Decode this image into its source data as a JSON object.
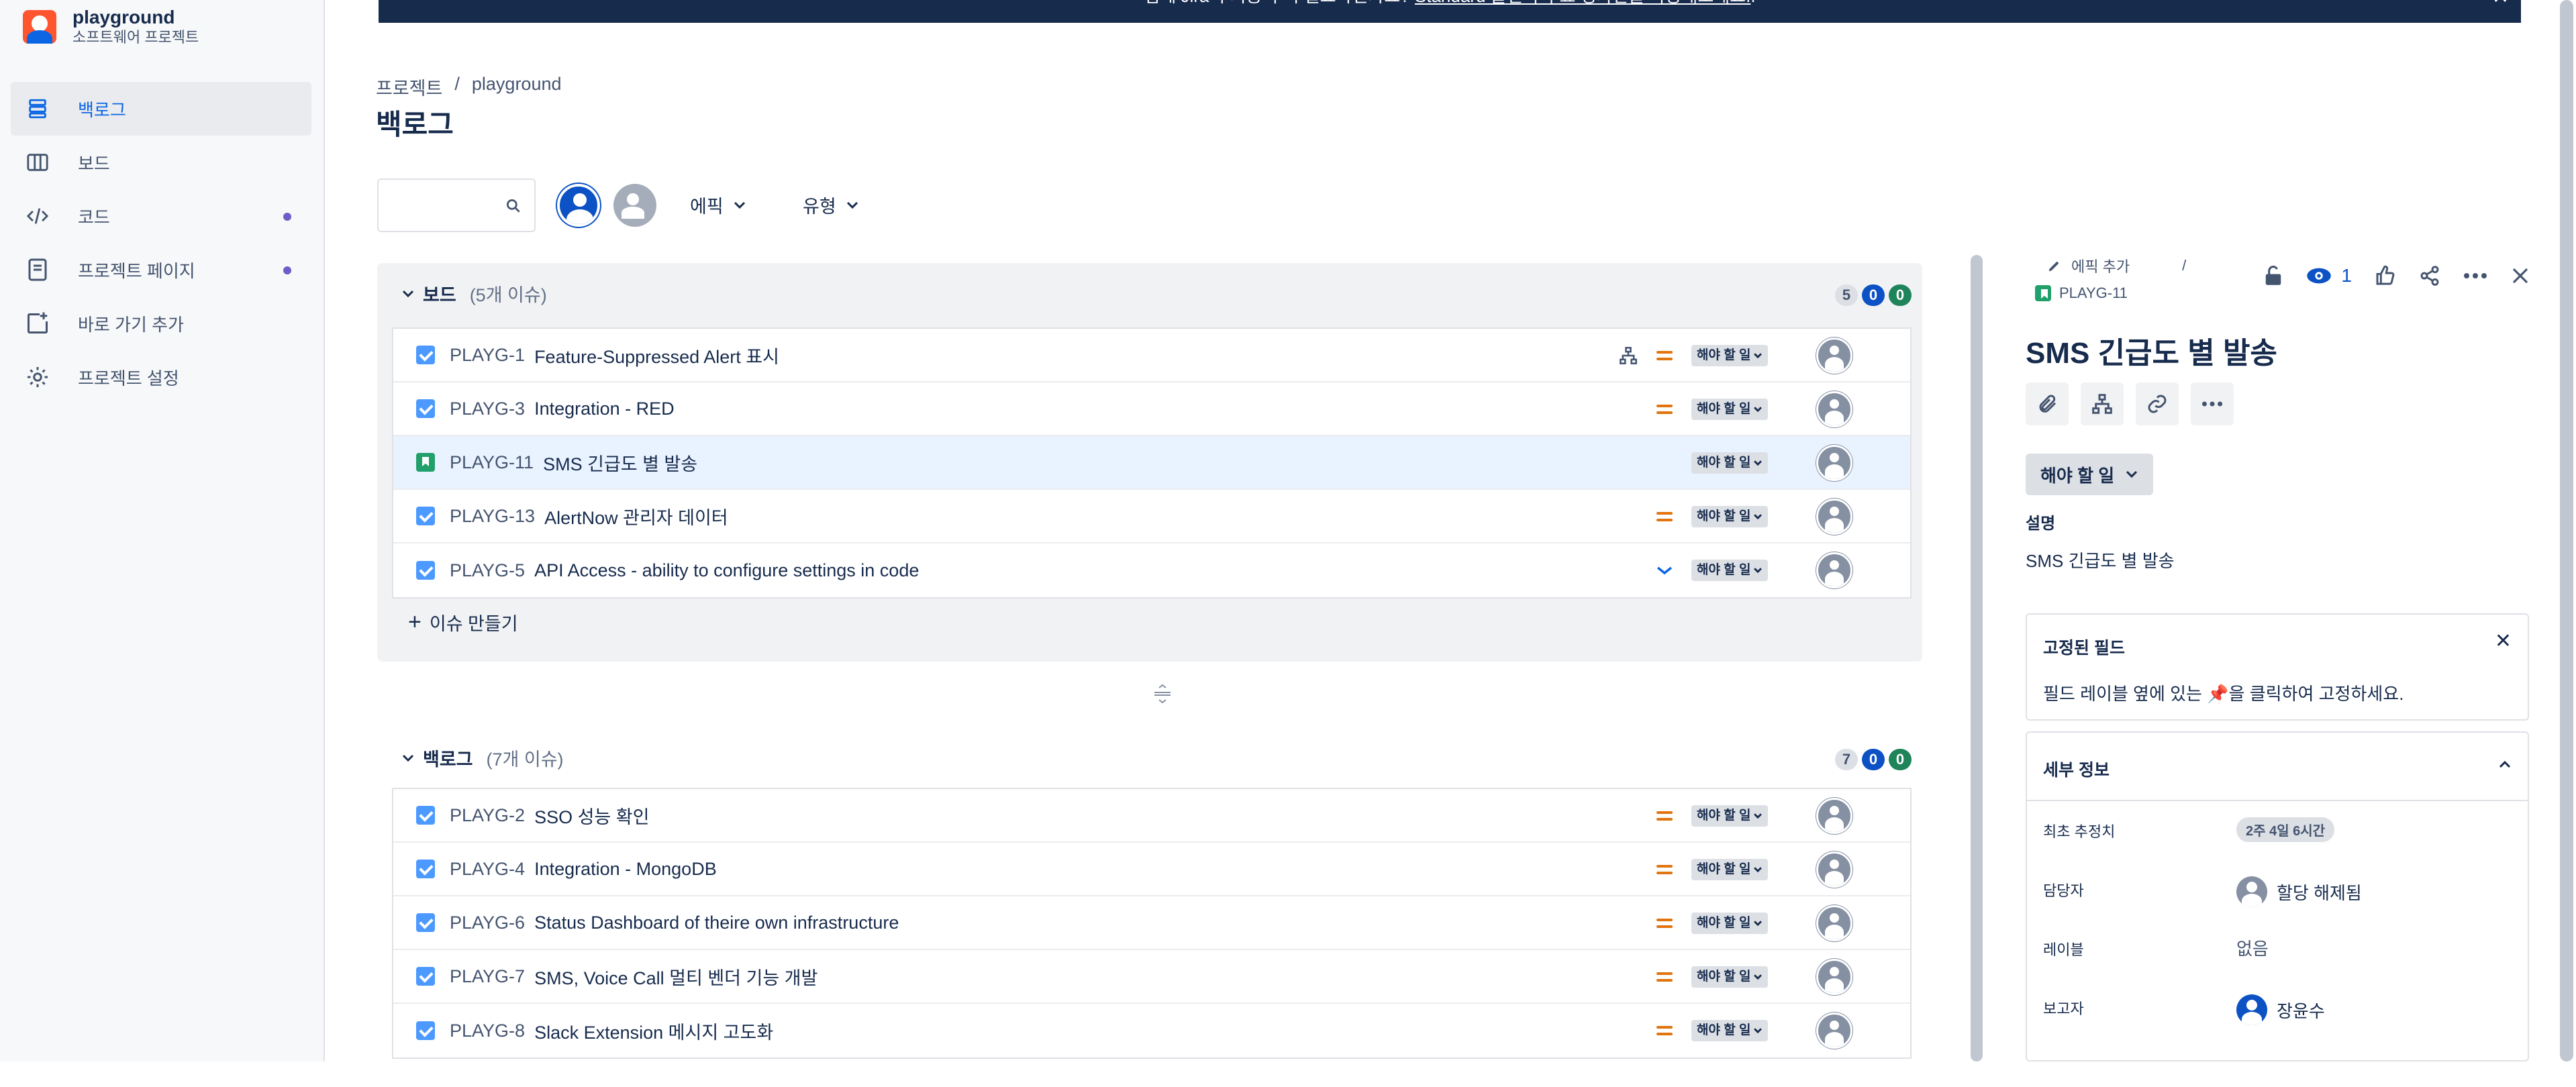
{
  "sidebar": {
    "project_name": "playground",
    "project_type": "소프트웨어 프로젝트",
    "items": [
      {
        "label": "백로그",
        "icon": "backlog-icon",
        "active": true
      },
      {
        "label": "보드",
        "icon": "board-icon"
      },
      {
        "label": "코드",
        "icon": "code-icon",
        "dot": true
      },
      {
        "label": "프로젝트 페이지",
        "icon": "page-icon",
        "dot": true
      },
      {
        "label": "바로 가기 추가",
        "icon": "add-shortcut-icon"
      },
      {
        "label": "프로젝트 설정",
        "icon": "settings-icon"
      }
    ]
  },
  "banner": {
    "text": "팀에 Jira의 기능이 더 필요하신가요?",
    "link": "Standard 플랜의 무료 평가판을 사용해보세요.",
    "tail": "."
  },
  "header": {
    "breadcrumb": [
      "프로젝트",
      "/",
      "playground"
    ],
    "title": "백로그"
  },
  "search": {
    "placeholder": ""
  },
  "filters": {
    "epic": "에픽",
    "type": "유형"
  },
  "board_section": {
    "title": "보드",
    "count": "(5개 이슈)",
    "counts": [
      "5",
      "0",
      "0"
    ],
    "create_label": "이슈 만들기",
    "issues": [
      {
        "key": "PLAYG-1",
        "summary": "Feature-Suppressed Alert 표시",
        "status": "해야 할 일",
        "priority": "medium",
        "type": "task",
        "child": true
      },
      {
        "key": "PLAYG-3",
        "summary": "Integration - RED",
        "status": "해야 할 일",
        "priority": "medium",
        "type": "task"
      },
      {
        "key": "PLAYG-11",
        "summary": "SMS 긴급도 별 발송",
        "status": "해야 할 일",
        "priority": "none",
        "type": "story",
        "selected": true
      },
      {
        "key": "PLAYG-13",
        "summary": "AlertNow 관리자 데이터",
        "status": "해야 할 일",
        "priority": "medium",
        "type": "task"
      },
      {
        "key": "PLAYG-5",
        "summary": "API Access - ability to configure settings in code",
        "status": "해야 할 일",
        "priority": "low",
        "type": "task"
      }
    ]
  },
  "backlog_section": {
    "title": "백로그",
    "count": "(7개 이슈)",
    "counts": [
      "7",
      "0",
      "0"
    ],
    "issues": [
      {
        "key": "PLAYG-2",
        "summary": "SSO 성능 확인",
        "status": "해야 할 일",
        "priority": "medium",
        "type": "task"
      },
      {
        "key": "PLAYG-4",
        "summary": "Integration - MongoDB",
        "status": "해야 할 일",
        "priority": "medium",
        "type": "task"
      },
      {
        "key": "PLAYG-6",
        "summary": "Status Dashboard of theire own infrastructure",
        "status": "해야 할 일",
        "priority": "medium",
        "type": "task"
      },
      {
        "key": "PLAYG-7",
        "summary": "SMS, Voice Call 멀티 벤더 기능 개발",
        "status": "해야 할 일",
        "priority": "medium",
        "type": "task"
      },
      {
        "key": "PLAYG-8",
        "summary": "Slack Extension 메시지 고도화",
        "status": "해야 할 일",
        "priority": "medium",
        "type": "task"
      }
    ]
  },
  "detail": {
    "add_epic": "에픽 추가",
    "separator": "/",
    "key": "PLAYG-11",
    "watchers": "1",
    "title": "SMS 긴급도 별 발송",
    "status": "해야 할 일",
    "description_label": "설명",
    "description": "SMS 긴급도 별 발송",
    "pinned": {
      "title": "고정된 필드",
      "text": "필드 레이블 옆에 있는 📌을 클릭하여 고정하세요."
    },
    "details": {
      "title": "세부 정보",
      "fields": [
        {
          "label": "최초 추정치",
          "value": "2주 4일 6시간"
        },
        {
          "label": "담당자",
          "value": "할당 해제됨"
        },
        {
          "label": "레이블",
          "value": "없음"
        },
        {
          "label": "보고자",
          "value": "장윤수"
        }
      ]
    }
  },
  "colors": {
    "accent": "#0c66e4",
    "selected_row": "#e9f2ff",
    "priority_medium": "#e2740f",
    "story": "#22a06b",
    "task": "#4c9aff"
  }
}
